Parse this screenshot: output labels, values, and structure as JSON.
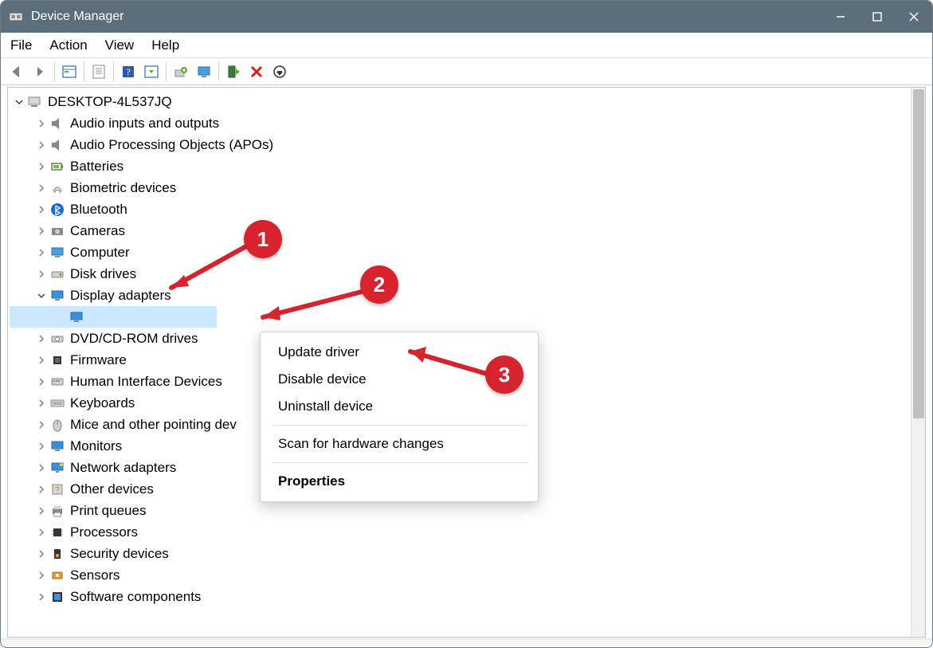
{
  "titlebar": {
    "title": "Device Manager"
  },
  "menubar": {
    "items": [
      "File",
      "Action",
      "View",
      "Help"
    ]
  },
  "tree": {
    "root": "DESKTOP-4L537JQ",
    "nodes": [
      {
        "label": "Audio inputs and outputs",
        "icon": "speaker"
      },
      {
        "label": "Audio Processing Objects (APOs)",
        "icon": "speaker"
      },
      {
        "label": "Batteries",
        "icon": "battery"
      },
      {
        "label": "Biometric devices",
        "icon": "fingerprint"
      },
      {
        "label": "Bluetooth",
        "icon": "bluetooth"
      },
      {
        "label": "Cameras",
        "icon": "camera"
      },
      {
        "label": "Computer",
        "icon": "computer"
      },
      {
        "label": "Disk drives",
        "icon": "disk"
      },
      {
        "label": "Display adapters",
        "icon": "display",
        "expanded": true,
        "children": [
          {
            "label": "",
            "icon": "display",
            "selected": true
          }
        ]
      },
      {
        "label": "DVD/CD-ROM drives",
        "icon": "disc"
      },
      {
        "label": "Firmware",
        "icon": "chip"
      },
      {
        "label": "Human Interface Devices",
        "icon": "hid"
      },
      {
        "label": "Keyboards",
        "icon": "keyboard"
      },
      {
        "label": "Mice and other pointing devices",
        "icon": "mouse",
        "truncated": "Mice and other pointing dev"
      },
      {
        "label": "Monitors",
        "icon": "display"
      },
      {
        "label": "Network adapters",
        "icon": "network"
      },
      {
        "label": "Other devices",
        "icon": "other"
      },
      {
        "label": "Print queues",
        "icon": "printer"
      },
      {
        "label": "Processors",
        "icon": "cpu"
      },
      {
        "label": "Security devices",
        "icon": "security"
      },
      {
        "label": "Sensors",
        "icon": "sensor"
      },
      {
        "label": "Software components",
        "icon": "software"
      }
    ]
  },
  "context_menu": {
    "items": [
      {
        "label": "Update driver"
      },
      {
        "label": "Disable device"
      },
      {
        "label": "Uninstall device"
      },
      {
        "sep": true
      },
      {
        "label": "Scan for hardware changes"
      },
      {
        "sep": true
      },
      {
        "label": "Properties",
        "bold": true
      }
    ]
  },
  "annotations": {
    "1": "1",
    "2": "2",
    "3": "3"
  }
}
